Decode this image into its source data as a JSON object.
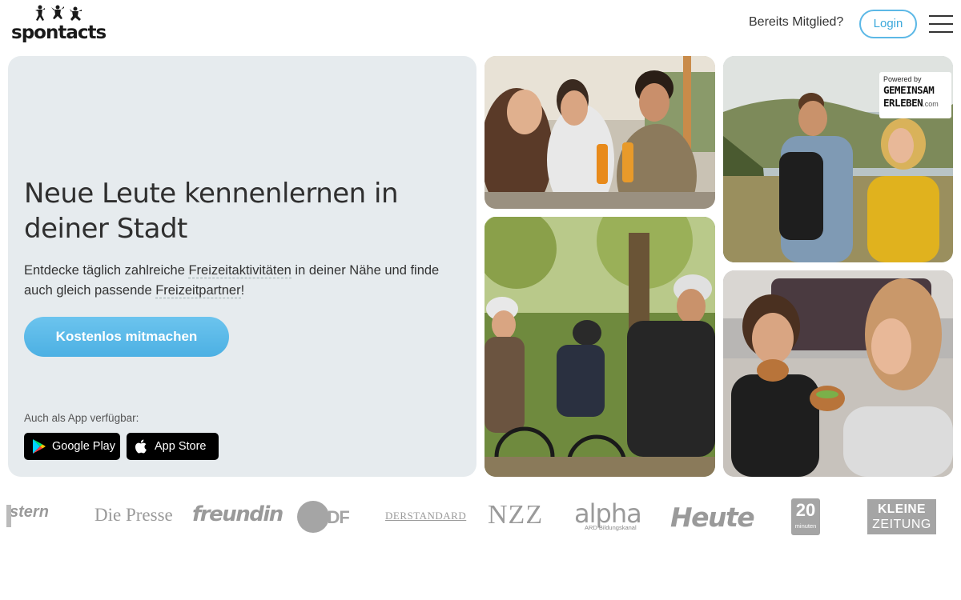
{
  "brand": {
    "name": "spontacts"
  },
  "header": {
    "member_question": "Bereits Mitglied?",
    "login_label": "Login",
    "menu_icon": "hamburger-menu-icon"
  },
  "hero": {
    "headline": "Neue Leute kennenlernen in deiner Stadt",
    "lead_part1": "Entdecke täglich zahlreiche ",
    "lead_link1": "Freizeitaktivitäten",
    "lead_part2": " in deiner Nähe und finde auch gleich passende ",
    "lead_link2": "Freizeitpartner",
    "lead_part3": "!",
    "cta_label": "Kostenlos mitmachen",
    "app_label": "Auch als App verfügbar:",
    "google_play_label": "Google Play",
    "app_store_label": "App Store"
  },
  "gallery": {
    "powered_by": "Powered by",
    "partner_line1": "GEMEINSAM",
    "partner_line2": "ERLEBEN",
    "partner_suffix": ".com"
  },
  "press_logos": {
    "stern": "stern",
    "presse": "Die Presse",
    "freundin": "freundin",
    "zdf": "ZDF",
    "standard": "DERSTANDARD",
    "nzz": "NZZ",
    "alpha": "alpha",
    "alpha_sub": "ARD Bildungskanal",
    "heute": "Heute",
    "twenty": "20",
    "twenty_sub": "minuten",
    "kleine_1": "KLEINE",
    "kleine_2": "ZEITUNG"
  },
  "colors": {
    "accent": "#4cb0e3",
    "hero_bg": "#e6ebee",
    "logo_grey": "#9a9a9a"
  }
}
